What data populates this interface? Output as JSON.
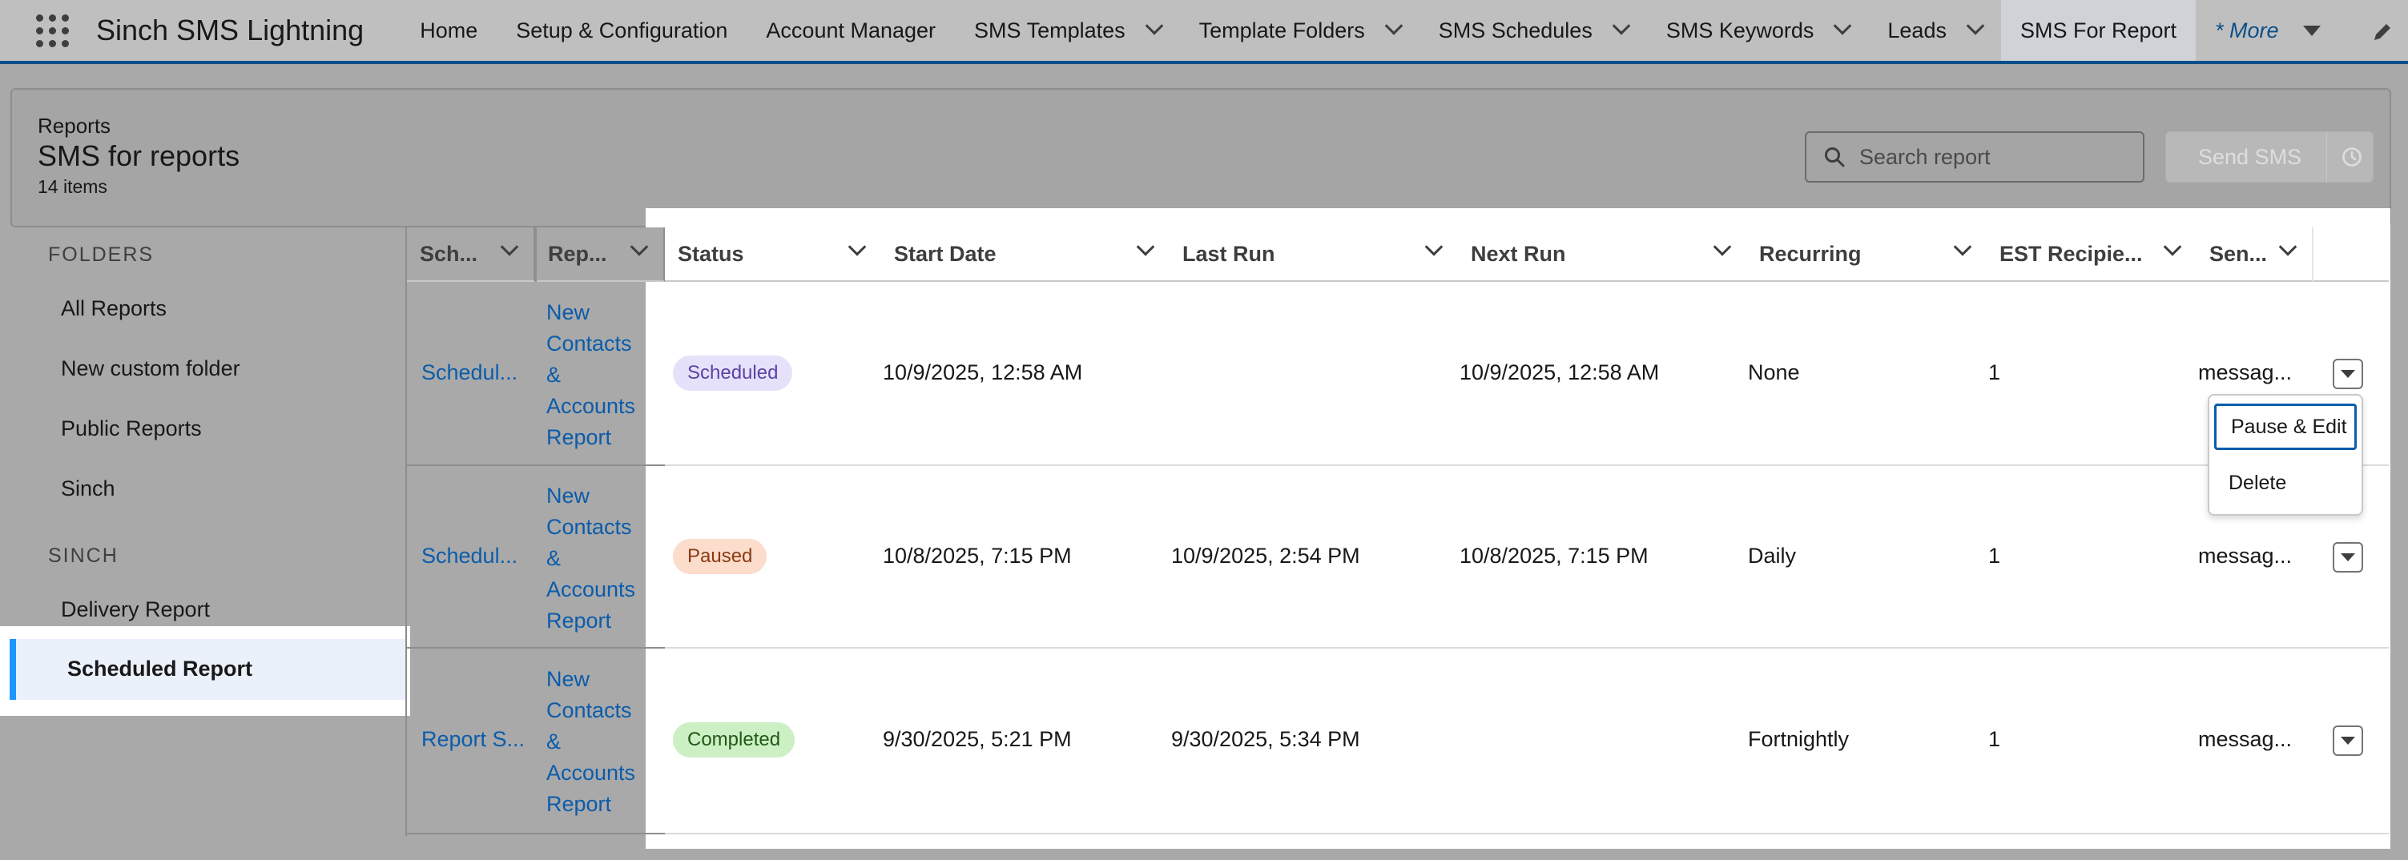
{
  "app": {
    "name": "Sinch SMS Lightning"
  },
  "nav": {
    "items": [
      {
        "label": "Home"
      },
      {
        "label": "Setup & Configuration"
      },
      {
        "label": "Account Manager"
      },
      {
        "label": "SMS Templates"
      },
      {
        "label": "Template Folders"
      },
      {
        "label": "SMS Schedules"
      },
      {
        "label": "SMS Keywords"
      },
      {
        "label": "Leads"
      },
      {
        "label": "SMS For Report"
      }
    ],
    "more_label": "* More",
    "active": "SMS For Report"
  },
  "header": {
    "eyebrow": "Reports",
    "title": "SMS for reports",
    "count": "14 items",
    "search_placeholder": "Search report",
    "send_label": "Send SMS"
  },
  "sidebar": {
    "folders_heading": "FOLDERS",
    "folders": [
      {
        "label": "All Reports"
      },
      {
        "label": "New custom folder"
      },
      {
        "label": "Public Reports"
      },
      {
        "label": "Sinch"
      }
    ],
    "sinch_heading": "SINCH",
    "sinch_items": [
      {
        "label": "Delivery Report"
      },
      {
        "label": "Scheduled Report"
      }
    ],
    "selected": "Scheduled Report"
  },
  "table": {
    "columns": [
      {
        "label": "Sch..."
      },
      {
        "label": "Rep..."
      },
      {
        "label": "Status"
      },
      {
        "label": "Start Date"
      },
      {
        "label": "Last Run"
      },
      {
        "label": "Next Run"
      },
      {
        "label": "Recurring"
      },
      {
        "label": "EST Recipie..."
      },
      {
        "label": "Sen..."
      }
    ],
    "rows": [
      {
        "schedule": "Schedul...",
        "report": [
          "New",
          "Contacts",
          "&",
          "Accounts",
          "Report"
        ],
        "status": "Scheduled",
        "start_date": "10/9/2025, 12:58 AM",
        "last_run": "",
        "next_run": "10/9/2025, 12:58 AM",
        "recurring": "None",
        "est_recipients": "1",
        "sender": "messag..."
      },
      {
        "schedule": "Schedul...",
        "report": [
          "New",
          "Contacts",
          "&",
          "Accounts",
          "Report"
        ],
        "status": "Paused",
        "start_date": "10/8/2025, 7:15 PM",
        "last_run": "10/9/2025, 2:54 PM",
        "next_run": "10/8/2025, 7:15 PM",
        "recurring": "Daily",
        "est_recipients": "1",
        "sender": "messag..."
      },
      {
        "schedule": "Report S...",
        "report": [
          "New",
          "Contacts",
          "&",
          "Accounts",
          "Report"
        ],
        "status": "Completed",
        "start_date": "9/30/2025, 5:21 PM",
        "last_run": "9/30/2025, 5:34 PM",
        "next_run": "",
        "recurring": "Fortnightly",
        "est_recipients": "1",
        "sender": "messag..."
      }
    ]
  },
  "row_menu": {
    "items": [
      {
        "label": "Pause & Edit"
      },
      {
        "label": "Delete"
      }
    ]
  },
  "colors": {
    "nav_accent": "#0b4f8a",
    "link": "#0b5cab",
    "selected_bar": "#1b96ff",
    "badge_scheduled_bg": "#e6e1fb",
    "badge_scheduled_fg": "#5a43a3",
    "badge_paused_bg": "#fcdccb",
    "badge_paused_fg": "#8a3a14",
    "badge_completed_bg": "#cdefc4",
    "badge_completed_fg": "#1f5a16"
  }
}
